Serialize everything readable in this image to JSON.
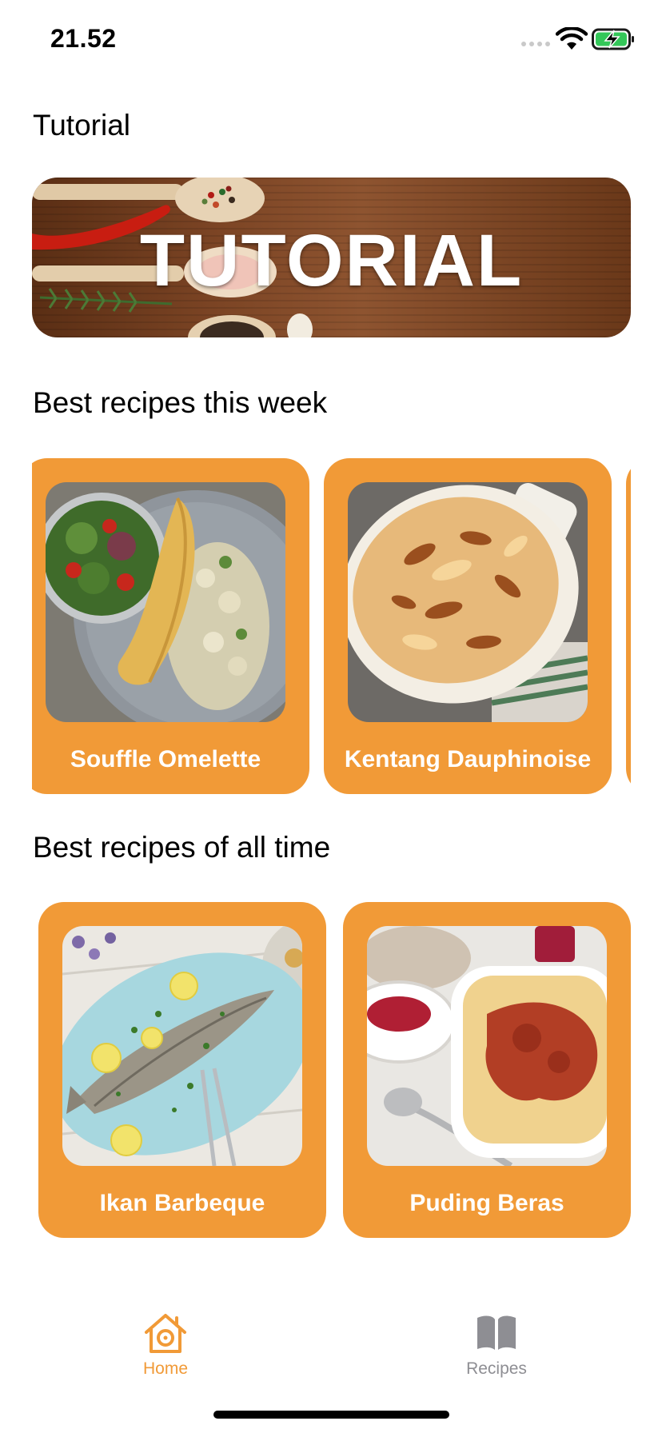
{
  "status_bar": {
    "time": "21.52",
    "icons": [
      "signal-icon",
      "wifi-icon",
      "battery-charging-icon"
    ]
  },
  "sections": {
    "tutorial_title": "Tutorial",
    "banner_text": "TUTORIAL",
    "week_title": "Best recipes this week",
    "alltime_title": "Best recipes of all time"
  },
  "week_recipes": [
    {
      "name": "Souffle Omelette"
    },
    {
      "name": "Kentang Dauphinoise"
    }
  ],
  "alltime_recipes": [
    {
      "name": "Ikan Barbeque"
    },
    {
      "name": "Puding Beras"
    }
  ],
  "tab_bar": {
    "home_label": "Home",
    "recipes_label": "Recipes",
    "home_icon": "house-icon",
    "recipes_icon": "book-icon",
    "active_color": "#f19a37",
    "inactive_color": "#8e8e93"
  },
  "colors": {
    "card_background": "#f19a37",
    "card_text": "#ffffff"
  }
}
